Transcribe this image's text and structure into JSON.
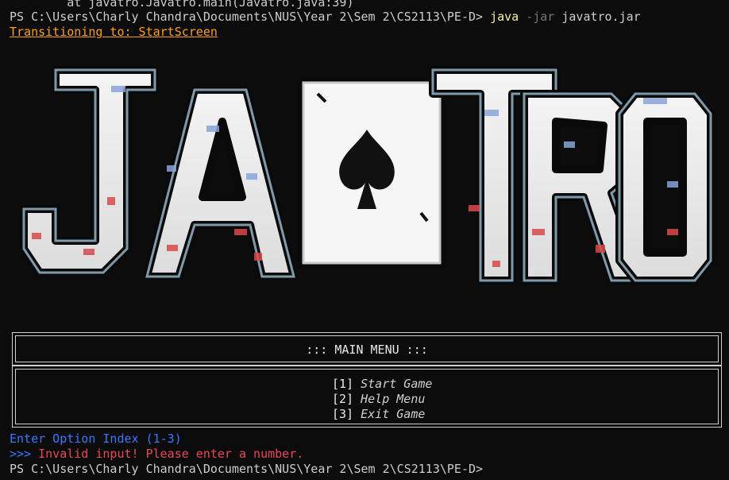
{
  "terminal": {
    "stack_trace_line": "        at javatro.Javatro.main(Javatro.java:39)",
    "prompt": "PS C:\\Users\\Charly Chandra\\Documents\\NUS\\Year 2\\Sem 2\\CS2113\\PE-D>",
    "command": {
      "program": "java",
      "flag": "-jar",
      "arg": "javatro.jar"
    },
    "transition_msg": "Transitioning to: StartScreen",
    "input_prompt": "Enter Option Index (1-3)",
    "error_prefix": ">>>",
    "error_msg": "Invalid input! Please enter a number."
  },
  "logo": {
    "left_text": "JA",
    "right_text": "TRO",
    "icon": "spade-card-icon"
  },
  "menu": {
    "title": "::: MAIN MENU :::",
    "options": [
      {
        "index": "[1]",
        "label": "Start Game"
      },
      {
        "index": "[2]",
        "label": "Help Menu"
      },
      {
        "index": "[3]",
        "label": "Exit Game"
      }
    ]
  },
  "colors": {
    "background": "#0c0c0c",
    "foreground": "#cccccc",
    "java_yellow": "#f9f1a5",
    "transition_orange": "#ff9f1c",
    "prompt_blue": "#3b78ff",
    "error_red": "#e74856"
  }
}
